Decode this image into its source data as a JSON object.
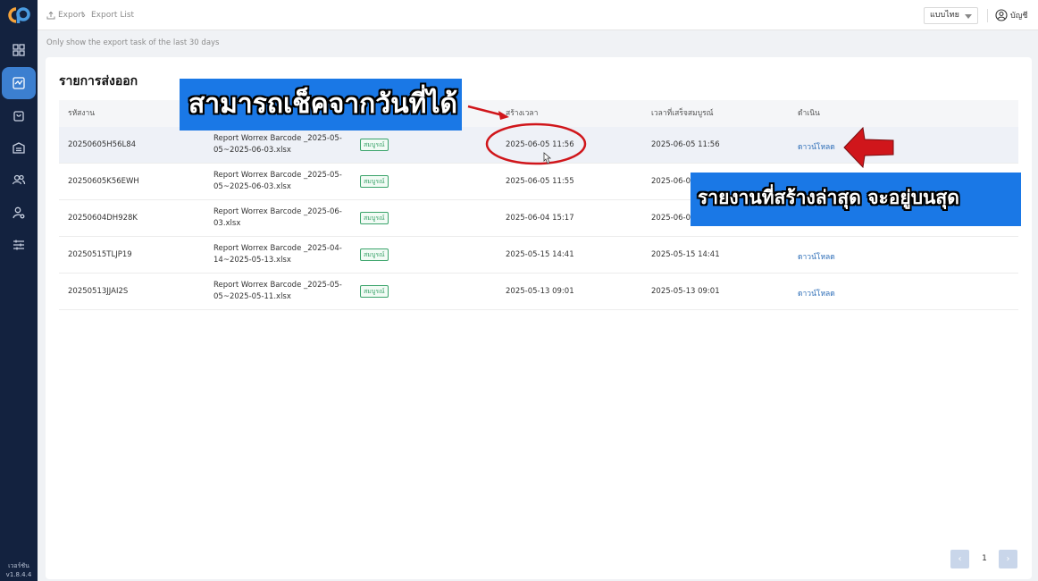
{
  "sidebar": {
    "items": [
      {
        "icon": "dashboard-icon"
      },
      {
        "icon": "export-icon",
        "active": true
      },
      {
        "icon": "bag-icon"
      },
      {
        "icon": "warehouse-icon"
      },
      {
        "icon": "users-icon"
      },
      {
        "icon": "user-settings-icon"
      },
      {
        "icon": "sliders-icon"
      }
    ],
    "version_label": "เวอร์ชัน",
    "version": "v1.8.4.4"
  },
  "header": {
    "breadcrumb": [
      "Export",
      "Export List"
    ],
    "language": "แบบไทย",
    "account": "บัญชี"
  },
  "note": "Only show the export task of the last 30 days",
  "card": {
    "title": "รายการส่งออก",
    "columns": [
      "รหัสงาน",
      "",
      "",
      "สร้างเวลา",
      "เวลาที่เสร็จสมบูรณ์",
      "ดำเนิน"
    ],
    "rows": [
      {
        "id": "20250605H56L84",
        "file": "Report Worrex Barcode _2025-05-05~2025-06-03.xlsx",
        "status": "สมบูรณ์",
        "created": "2025-06-05 11:56",
        "completed": "2025-06-05 11:56",
        "action": "ดาวน์โหลด"
      },
      {
        "id": "20250605K56EWH",
        "file": "Report Worrex Barcode _2025-05-05~2025-06-03.xlsx",
        "status": "สมบูรณ์",
        "created": "2025-06-05 11:55",
        "completed": "2025-06-05",
        "action": ""
      },
      {
        "id": "20250604DH928K",
        "file": "Report Worrex Barcode _2025-06-03.xlsx",
        "status": "สมบูรณ์",
        "created": "2025-06-04 15:17",
        "completed": "2025-06-04",
        "action": ""
      },
      {
        "id": "20250515TLJP19",
        "file": "Report Worrex Barcode _2025-04-14~2025-05-13.xlsx",
        "status": "สมบูรณ์",
        "created": "2025-05-15 14:41",
        "completed": "2025-05-15 14:41",
        "action": "ดาวน์โหลด"
      },
      {
        "id": "20250513JJAI2S",
        "file": "Report Worrex Barcode _2025-05-05~2025-05-11.xlsx",
        "status": "สมบูรณ์",
        "created": "2025-05-13 09:01",
        "completed": "2025-05-13 09:01",
        "action": "ดาวน์โหลด"
      }
    ]
  },
  "pagination": {
    "current": "1",
    "prev": "‹",
    "next": "›"
  },
  "annotations": {
    "callout_1": "สามารถเช็คจากวันที่ได้",
    "callout_2": "รายงานที่สร้างล่าสุด จะอยู่บนสุด"
  },
  "colors": {
    "sidebar": "#13223f",
    "active": "#3c7fd0",
    "callout": "#1a78e6",
    "annotation": "#d0161b",
    "link": "#2f6fb8",
    "badge": "#3aa36a"
  }
}
